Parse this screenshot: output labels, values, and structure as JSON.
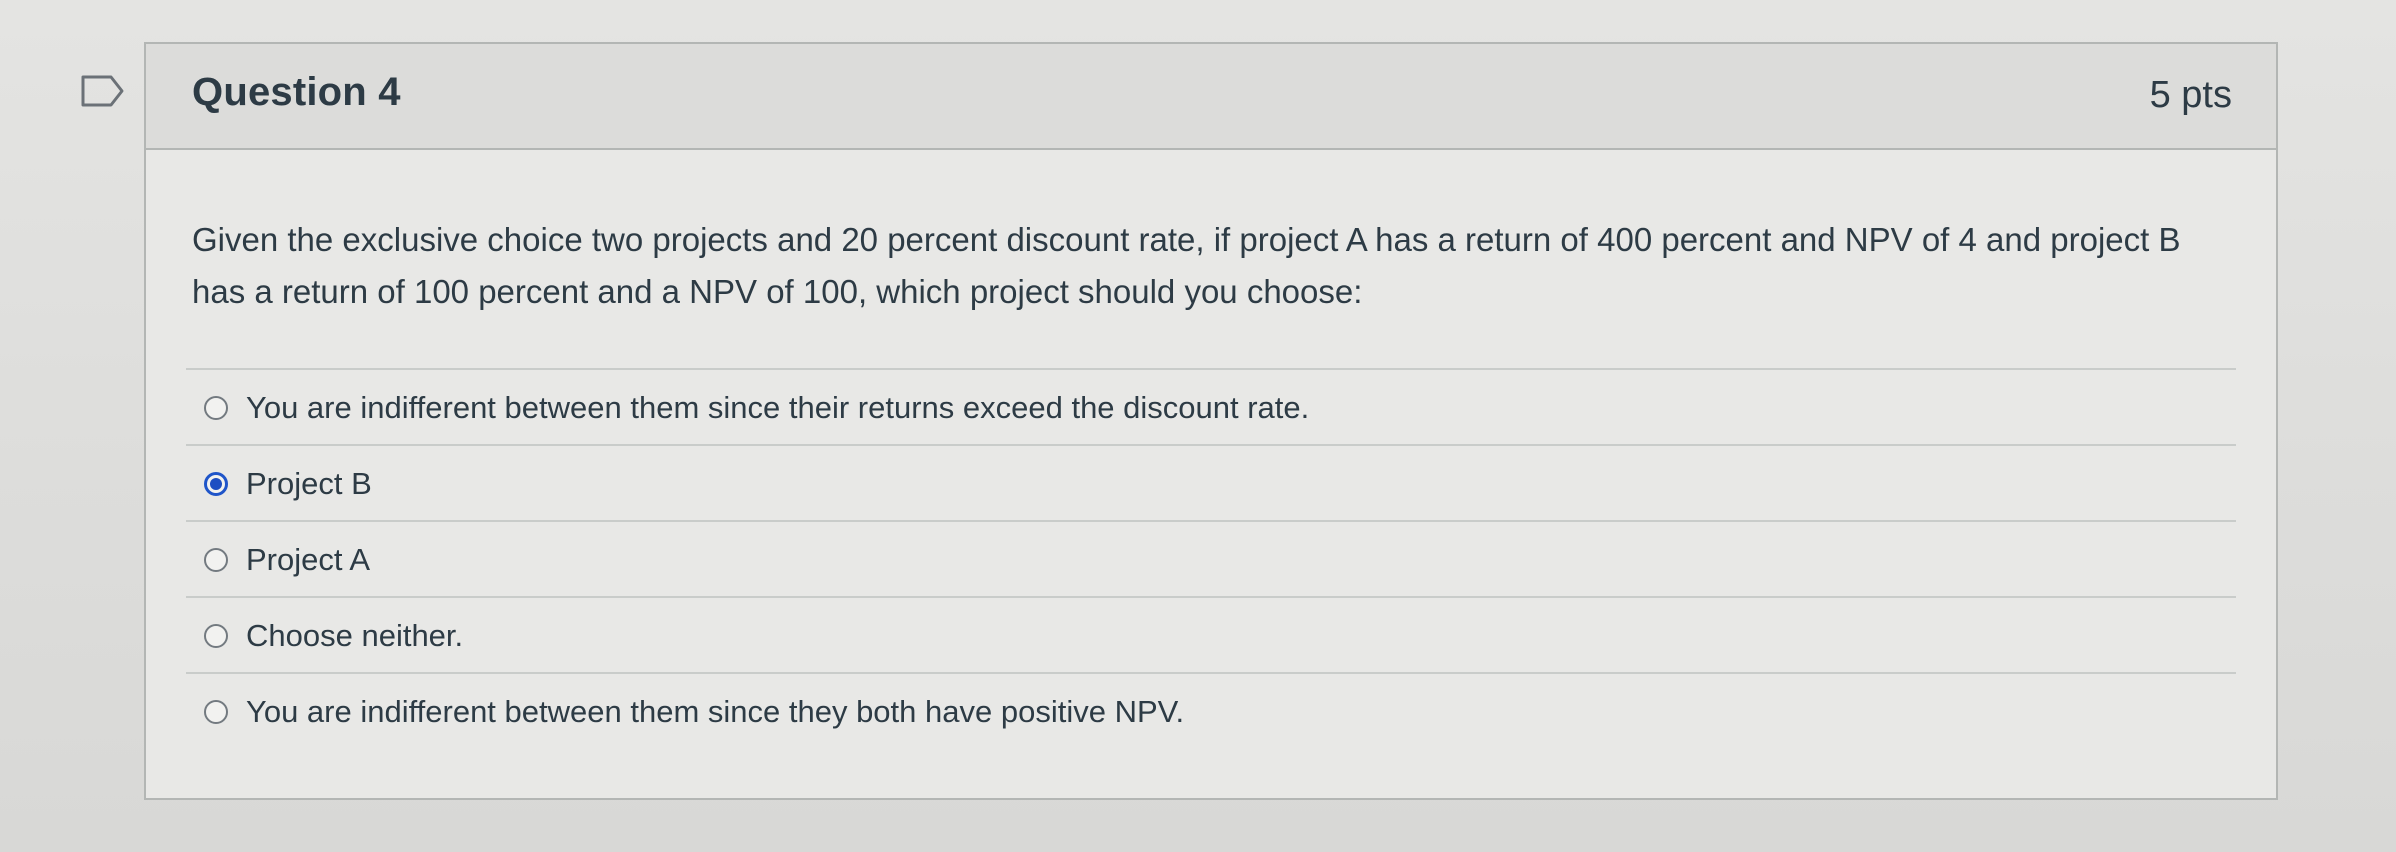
{
  "question": {
    "title": "Question 4",
    "points": "5 pts",
    "text": "Given the exclusive choice two projects and 20 percent discount rate, if project A has a return of 400 percent and NPV of 4 and project B has a return of 100 percent and a NPV of 100, which project should you choose:",
    "answers": [
      {
        "label": "You are indifferent between them since their returns exceed the discount rate.",
        "selected": false
      },
      {
        "label": "Project B",
        "selected": true
      },
      {
        "label": "Project A",
        "selected": false
      },
      {
        "label": "Choose neither.",
        "selected": false
      },
      {
        "label": "You are indifferent between them since they both have positive NPV.",
        "selected": false
      }
    ]
  },
  "icons": {
    "bookmark": "bookmark-flag-icon",
    "radio": "radio-button-icon"
  },
  "colors": {
    "text": "#2d3b45",
    "accent": "#1d4ec2",
    "border": "#b3b6b4"
  }
}
